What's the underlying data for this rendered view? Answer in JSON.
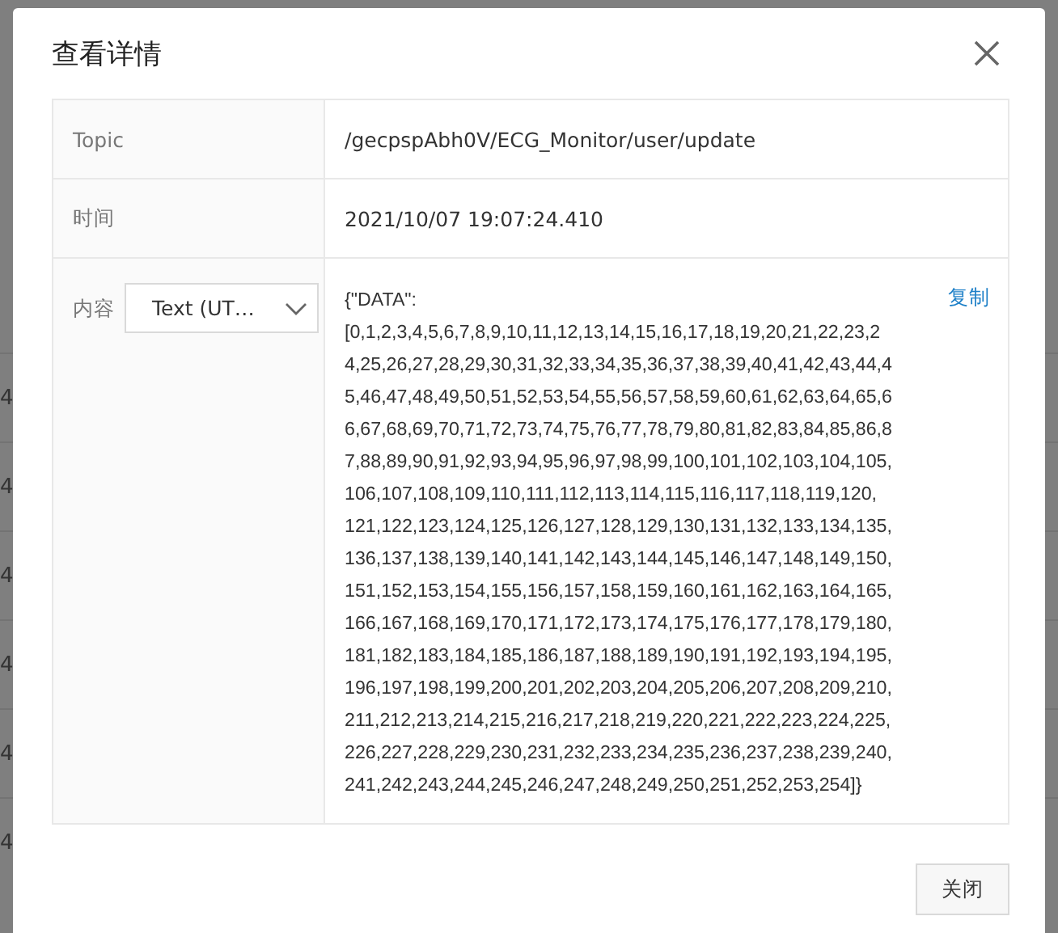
{
  "background": {
    "cells": [
      "4",
      "4",
      "4",
      "4",
      "4",
      "4"
    ]
  },
  "dialog": {
    "title": "查看详情",
    "rows": [
      {
        "label": "Topic",
        "value": "/gecpspAbh0V/ECG_Monitor/user/update"
      },
      {
        "label": "时间",
        "value": "2021/10/07 19:07:24.410"
      }
    ],
    "content": {
      "label": "内容",
      "format_select": "Text (UT…",
      "lines": [
        "{\"DATA\":",
        "[0,1,2,3,4,5,6,7,8,9,10,11,12,13,14,15,16,17,18,19,20,21,22,23,2",
        "4,25,26,27,28,29,30,31,32,33,34,35,36,37,38,39,40,41,42,43,44,4",
        "5,46,47,48,49,50,51,52,53,54,55,56,57,58,59,60,61,62,63,64,65,6",
        "6,67,68,69,70,71,72,73,74,75,76,77,78,79,80,81,82,83,84,85,86,8",
        "7,88,89,90,91,92,93,94,95,96,97,98,99,100,101,102,103,104,105,",
        "106,107,108,109,110,111,112,113,114,115,116,117,118,119,120,",
        "121,122,123,124,125,126,127,128,129,130,131,132,133,134,135,",
        "136,137,138,139,140,141,142,143,144,145,146,147,148,149,150,",
        "151,152,153,154,155,156,157,158,159,160,161,162,163,164,165,",
        "166,167,168,169,170,171,172,173,174,175,176,177,178,179,180,",
        "181,182,183,184,185,186,187,188,189,190,191,192,193,194,195,",
        "196,197,198,199,200,201,202,203,204,205,206,207,208,209,210,",
        "211,212,213,214,215,216,217,218,219,220,221,222,223,224,225,",
        "226,227,228,229,230,231,232,233,234,235,236,237,238,239,240,",
        "241,242,243,244,245,246,247,248,249,250,251,252,253,254]}"
      ],
      "copy_link": "复制"
    },
    "close_button": "关闭"
  }
}
